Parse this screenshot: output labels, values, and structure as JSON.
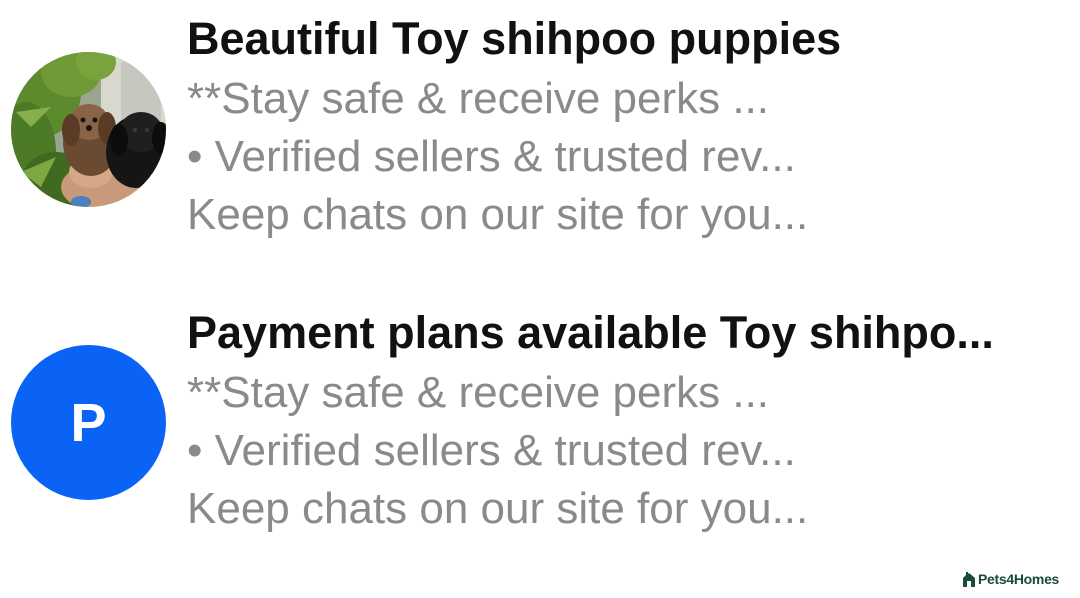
{
  "conversations": [
    {
      "title": "Beautiful Toy shihpoo puppies",
      "preview_lines": [
        "**Stay safe & receive perks ...",
        "• Verified sellers & trusted rev...",
        "Keep chats on our site for you..."
      ],
      "avatar": {
        "type": "photo",
        "subject": "two dark puppies held in a hand among green foliage"
      }
    },
    {
      "title": "Payment plans available Toy shihpo...",
      "preview_lines": [
        "**Stay safe & receive perks ...",
        "• Verified sellers & trusted rev...",
        "Keep chats on our site for you..."
      ],
      "avatar": {
        "type": "initial",
        "letter": "P",
        "color": "#0b63f6"
      }
    }
  ],
  "watermark": {
    "name": "Pets4Homes",
    "icon": "pets4homes-logo-icon",
    "color": "#1a4a3a"
  },
  "colors": {
    "title": "#111111",
    "preview": "#8a8a8a",
    "initial_avatar": "#0b63f6"
  }
}
